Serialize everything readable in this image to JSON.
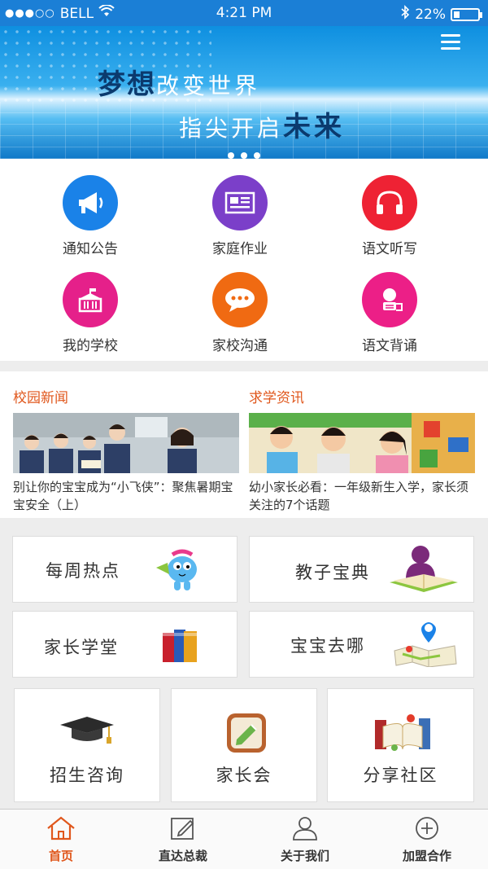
{
  "status_bar": {
    "signal": "●●●○○",
    "carrier": "BELL",
    "time": "4:21 PM",
    "battery": "22%"
  },
  "banner": {
    "slogan_line1_a": "梦想",
    "slogan_line1_b": "改变世界",
    "slogan_line2_a": "指尖开启",
    "slogan_line2_b": "未来"
  },
  "features": [
    {
      "label": "通知公告",
      "color": "#1a82e8",
      "icon": "megaphone-icon"
    },
    {
      "label": "家庭作业",
      "color": "#7b3fc9",
      "icon": "newspaper-icon"
    },
    {
      "label": "语文听写",
      "color": "#ee2234",
      "icon": "headphones-icon"
    },
    {
      "label": "我的学校",
      "color": "#e5208a",
      "icon": "school-icon"
    },
    {
      "label": "家校沟通",
      "color": "#f06a12",
      "icon": "chat-icon"
    },
    {
      "label": "语文背诵",
      "color": "#ec1f87",
      "icon": "recite-icon"
    }
  ],
  "news": {
    "campus": {
      "title": "校园新闻",
      "text": "别让你的宝宝成为“小飞侠”：聚焦暑期宝宝安全（上）"
    },
    "study": {
      "title": "求学资讯",
      "text": "幼小家长必看：一年级新生入学，家长须关注的7个话题"
    }
  },
  "cards": {
    "weekly": "每周热点",
    "teaching": "教子宝典",
    "school": "家长学堂",
    "where": "宝宝去哪",
    "enroll": "招生咨询",
    "meeting": "家长会",
    "share": "分享社区"
  },
  "tabs": [
    {
      "label": "首页",
      "icon": "home-icon"
    },
    {
      "label": "直达总裁",
      "icon": "edit-icon"
    },
    {
      "label": "关于我们",
      "icon": "user-icon"
    },
    {
      "label": "加盟合作",
      "icon": "plus-circle-icon"
    }
  ],
  "colors": {
    "accent": "#e0571c",
    "status_bar": "#1b7fd6"
  }
}
